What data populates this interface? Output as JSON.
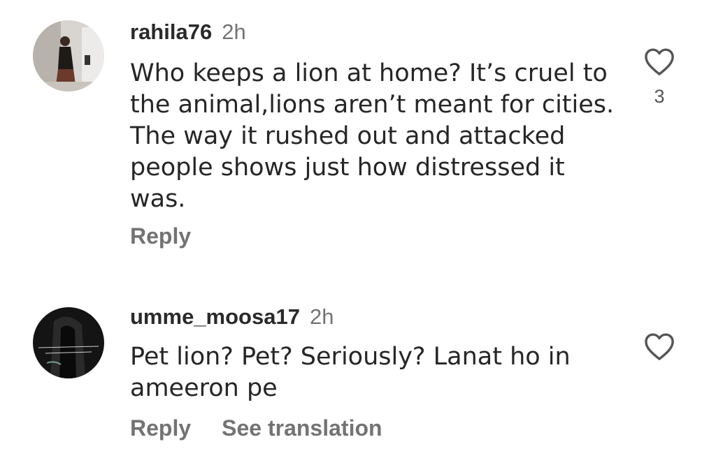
{
  "comments": [
    {
      "username": "rahila76",
      "time": "2h",
      "text": "Who keeps a lion at home? It’s cruel to the animal,lions aren’t meant for cities. The way it rushed out and attacked people shows just how distressed it was.",
      "reply_label": "Reply",
      "like_count": "3",
      "like_icon": "heart-outline-icon"
    },
    {
      "username": "umme_moosa17",
      "time": "2h",
      "text": "Pet lion? Pet? Seriously? Lanat ho in ameeron pe",
      "reply_label": "Reply",
      "translate_label": "See translation",
      "like_icon": "heart-outline-icon"
    }
  ]
}
